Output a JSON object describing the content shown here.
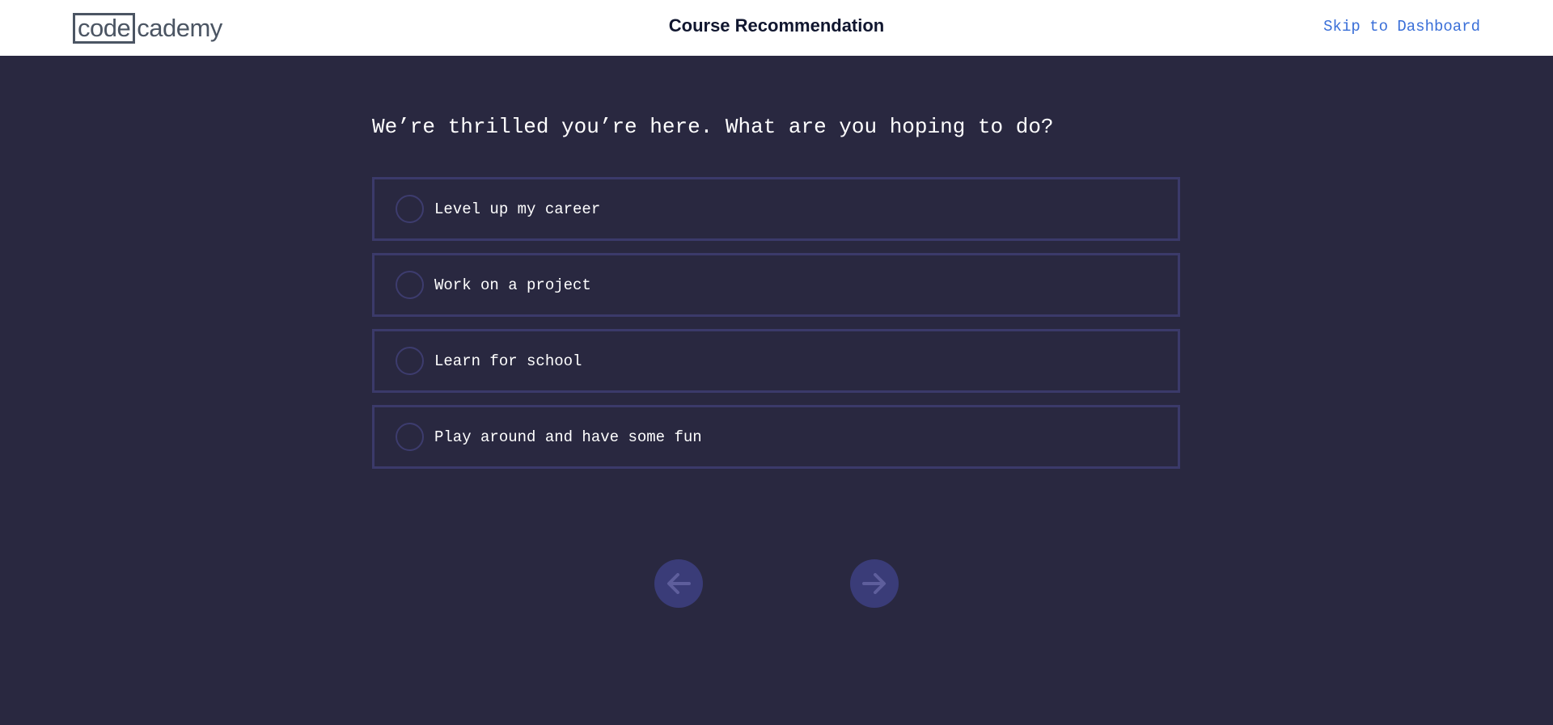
{
  "header": {
    "logo_boxed": "code",
    "logo_rest": "cademy",
    "title": "Course Recommendation",
    "skip_label": "Skip to Dashboard"
  },
  "question": "We’re thrilled you’re here. What are you hoping to do?",
  "options": [
    {
      "label": "Level up my career",
      "selected": false
    },
    {
      "label": "Work on a project",
      "selected": false
    },
    {
      "label": "Learn for school",
      "selected": false
    },
    {
      "label": "Play around and have some fun",
      "selected": false
    }
  ],
  "navigation": {
    "back_icon": "arrow-left-icon",
    "next_icon": "arrow-right-icon",
    "back_enabled": false,
    "next_enabled": false
  },
  "colors": {
    "background": "#292840",
    "option_border": "#3b3a6a",
    "link": "#3a6fd8",
    "nav_button": "#3a3c78",
    "nav_arrow": "#5e5e9c"
  }
}
